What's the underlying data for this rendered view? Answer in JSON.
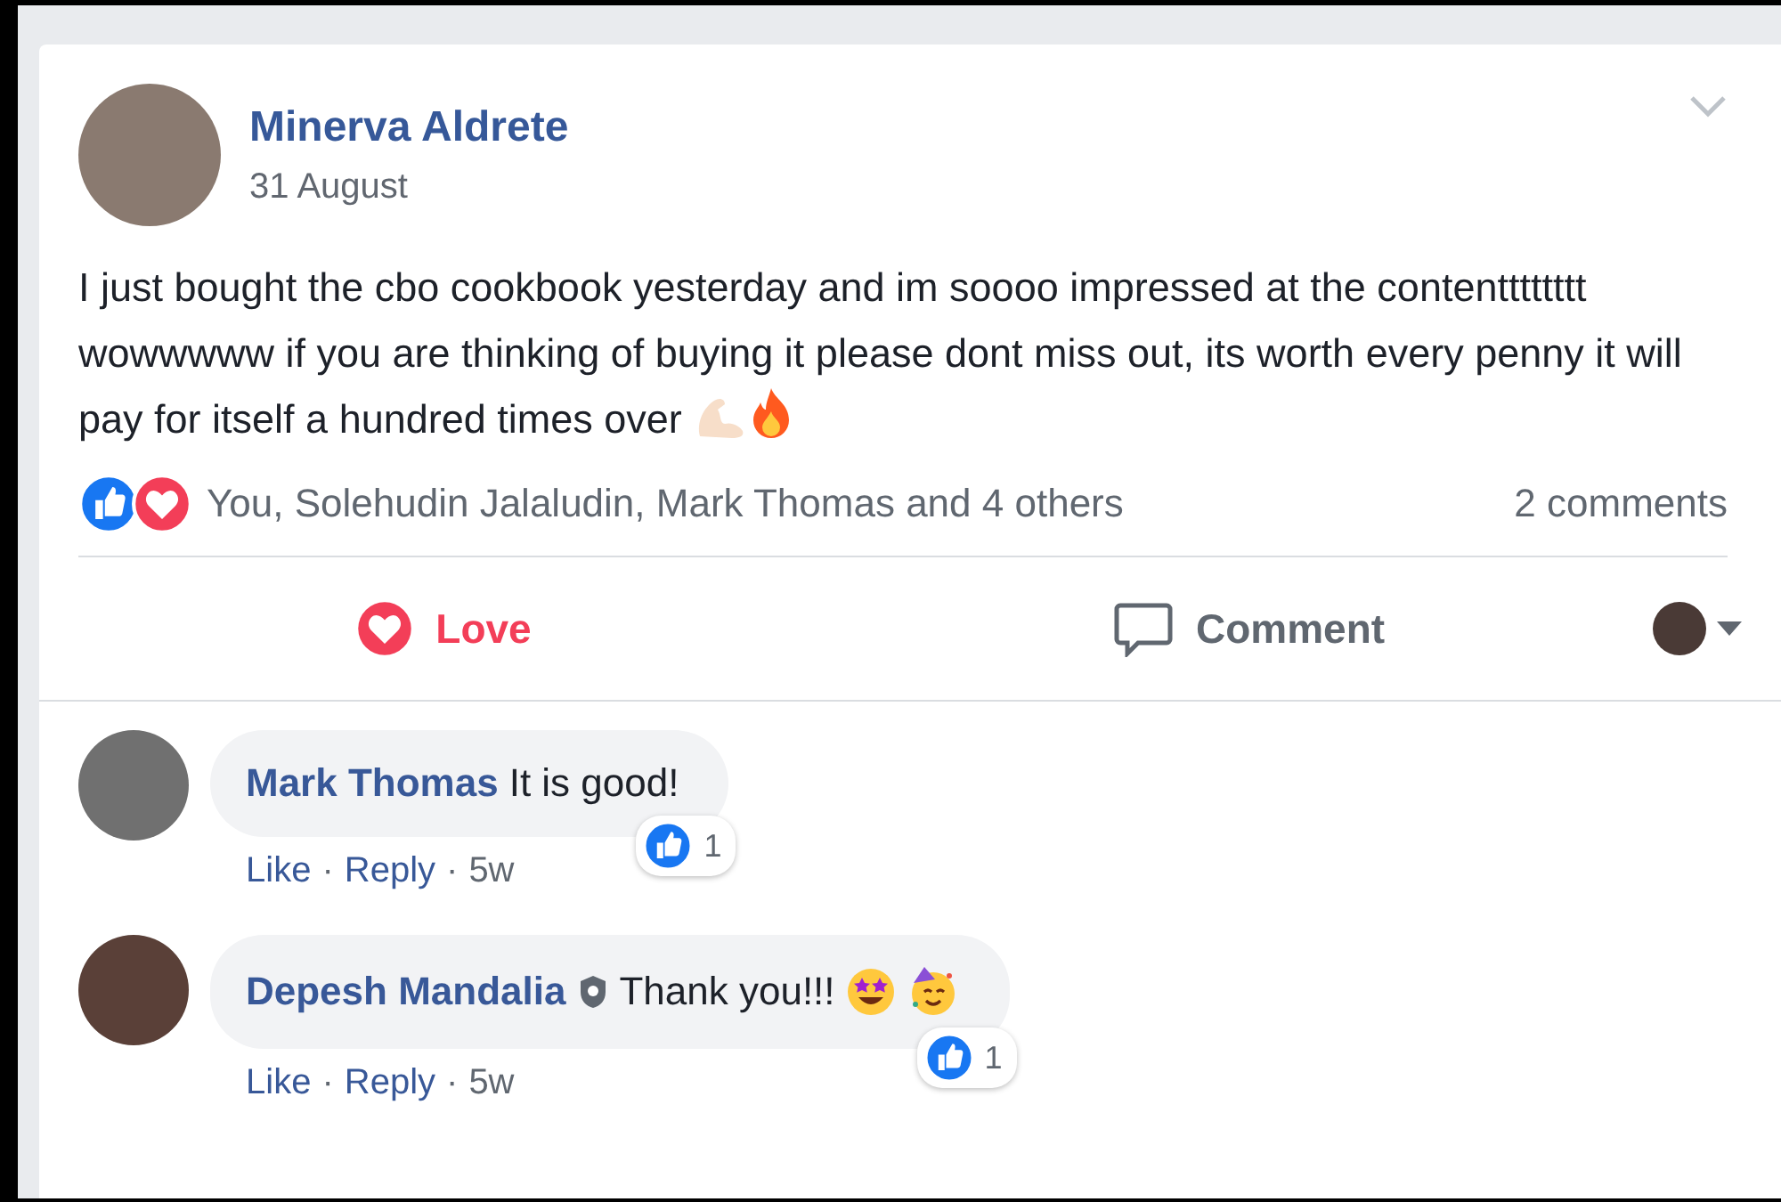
{
  "post": {
    "author": "Minerva Aldrete",
    "date": "31 August",
    "text": "I just bought the cbo cookbook yesterday and im soooo impressed at the contentttttttt wowwwww if you are thinking of buying it please dont miss out, its worth every penny it will pay for itself a hundred times over",
    "reactions_summary": "You, Solehudin Jalaludin, Mark Thomas and 4 others",
    "comment_count": "2 comments"
  },
  "actions": [
    {
      "kind": "love",
      "label": "Love",
      "selected": true
    },
    {
      "kind": "comment",
      "label": "Comment",
      "selected": false
    }
  ],
  "separator": "·",
  "comments": [
    {
      "author": "Mark Thomas",
      "verified": false,
      "text": "It is good!",
      "kind": "plain",
      "like_count": "1",
      "actions": [
        "Like",
        "Reply"
      ],
      "time": "5w"
    },
    {
      "author": "Depesh Mandalia",
      "verified": true,
      "text": "Thank you!!!",
      "kind": "emoji",
      "like_count": "1",
      "actions": [
        "Like",
        "Reply"
      ],
      "time": "5w"
    }
  ]
}
